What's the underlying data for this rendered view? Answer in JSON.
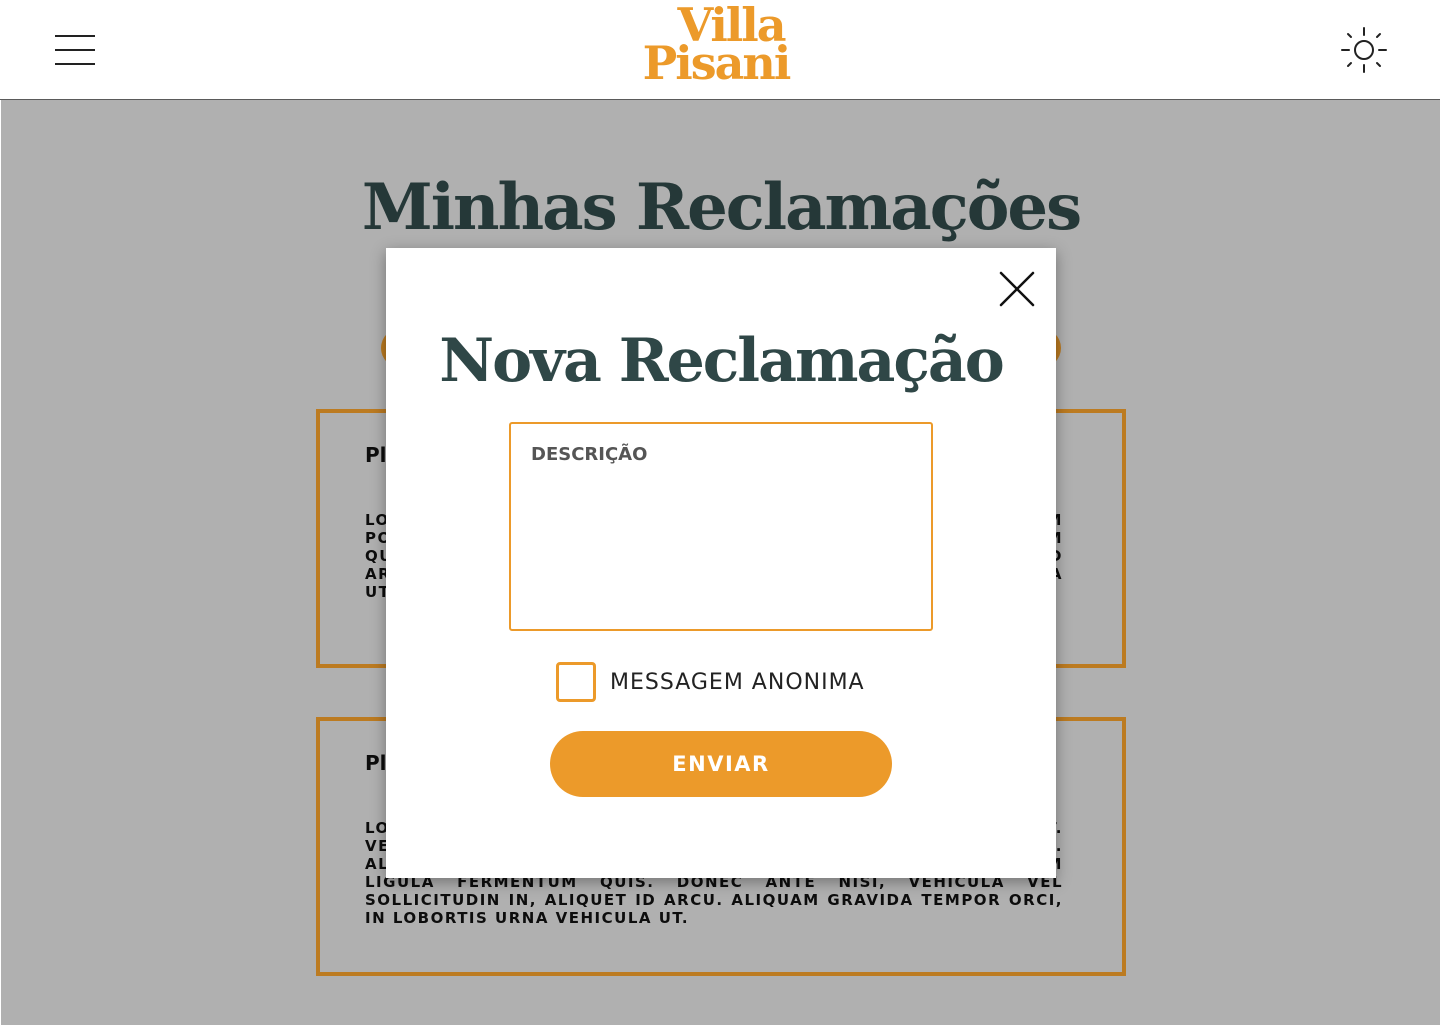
{
  "header": {
    "logo_line1": "Villa",
    "logo_line2": "Pisani",
    "menu_icon": "hamburger-menu-icon",
    "theme_icon": "sun-icon"
  },
  "page": {
    "title": "Minhas Reclamações",
    "cards": [
      {
        "title": "Pl",
        "text": "Lorem ipsum dolor sit amet, consectetur adipiscing elit. Nam porttitor pellentesque tellus, sed dictum ligula fermentum quis. Donec ante nisi, vehicula vel sollicitudin in, aliquet id arcu. Aliquam gravida tempor orci, in lobortis urna vehicula ut."
      },
      {
        "title": "Pl",
        "text": "Lorem ipsum dolor sit amet, consectetur adipiscing elit. Vestibulum ullamcorper tincidunt nisl, vel vehicula lacus. Aliquet sed. Nam porttitor pellentesque tellus, sed dictum ligula fermentum quis. Donec ante nisi, vehicula vel sollicitudin in, aliquet id arcu. Aliquam gravida tempor orci, in lobortis urna vehicula ut."
      }
    ]
  },
  "modal": {
    "title": "Nova Reclamação",
    "description_placeholder": "DESCRIÇÃO",
    "description_value": "",
    "anonymous_label": "MESSAGEM ANONIMA",
    "anonymous_checked": false,
    "send_label": "ENVIAR",
    "close_icon": "close-icon"
  },
  "colors": {
    "accent": "#ec9a2a",
    "title": "#2f4747",
    "overlay": "#b2b2b2"
  }
}
